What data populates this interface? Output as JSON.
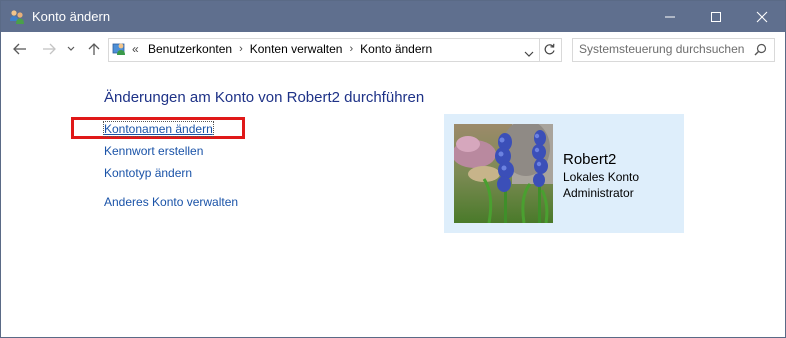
{
  "window": {
    "title": "Konto ändern"
  },
  "address_bar": {
    "overflow_label": "«",
    "breadcrumbs": [
      "Benutzerkonten",
      "Konten verwalten",
      "Konto ändern"
    ]
  },
  "search": {
    "placeholder": "Systemsteuerung durchsuchen"
  },
  "main": {
    "heading": "Änderungen am Konto von Robert2 durchführen",
    "links": [
      "Kontonamen ändern",
      "Kennwort erstellen",
      "Kontotyp ändern",
      "Anderes Konto verwalten"
    ]
  },
  "account": {
    "name": "Robert2",
    "type": "Lokales Konto",
    "role": "Administrator"
  },
  "colors": {
    "titlebar": "#5f6f8e",
    "heading": "#1e3287",
    "link": "#1a53a8",
    "card_bg": "#deeefb",
    "highlight": "#e01818"
  },
  "icons": {
    "app": "users-icon",
    "back": "back-arrow-icon",
    "forward": "forward-arrow-icon",
    "recent": "chevron-down-icon",
    "up": "up-arrow-icon",
    "refresh": "refresh-icon",
    "search": "search-icon"
  }
}
